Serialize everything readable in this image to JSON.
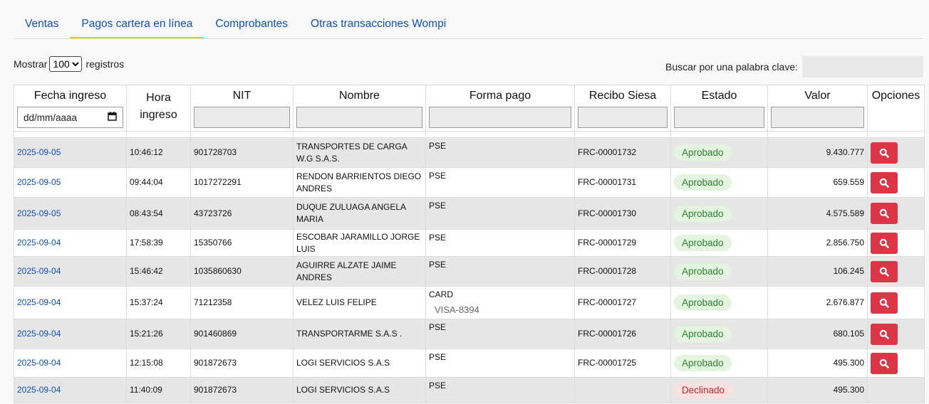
{
  "tabs": [
    {
      "label": "Ventas"
    },
    {
      "label": "Pagos cartera en línea"
    },
    {
      "label": "Comprobantes"
    },
    {
      "label": "Otras transacciones Wompi"
    }
  ],
  "controls": {
    "mostrar_label": "Mostrar",
    "page_size": "100",
    "registros_label": "registros",
    "search_label": "Buscar por una palabra clave:"
  },
  "headers": {
    "fecha": "Fecha ingreso",
    "hora_1": "Hora",
    "hora_2": "ingreso",
    "nit": "NIT",
    "nombre": "Nombre",
    "forma": "Forma pago",
    "recibo": "Recibo Siesa",
    "estado": "Estado",
    "valor": "Valor",
    "opciones": "Opciones",
    "date_placeholder": "dd/mm/aaaa"
  },
  "rows": [
    {
      "fecha": "2025-09-05",
      "hora": "10:46:12",
      "nit": "901728703",
      "nombre": "TRANSPORTES DE CARGA W.G S.A.S.",
      "forma": "PSE",
      "forma_detail": "",
      "recibo": "FRC-00001732",
      "estado": "Aprobado",
      "valor": "9.430.777"
    },
    {
      "fecha": "2025-09-05",
      "hora": "09:44:04",
      "nit": "1017272291",
      "nombre": "RENDON BARRIENTOS DIEGO ANDRES",
      "forma": "PSE",
      "forma_detail": "",
      "recibo": "FRC-00001731",
      "estado": "Aprobado",
      "valor": "659.559"
    },
    {
      "fecha": "2025-09-05",
      "hora": "08:43:54",
      "nit": "43723726",
      "nombre": "DUQUE ZULUAGA ANGELA MARIA",
      "forma": "PSE",
      "forma_detail": "",
      "recibo": "FRC-00001730",
      "estado": "Aprobado",
      "valor": "4.575.589"
    },
    {
      "fecha": "2025-09-04",
      "hora": "17:58:39",
      "nit": "15350766",
      "nombre": "ESCOBAR JARAMILLO JORGE LUIS",
      "forma": "PSE",
      "forma_detail": "",
      "recibo": "FRC-00001729",
      "estado": "Aprobado",
      "valor": "2.856.750"
    },
    {
      "fecha": "2025-09-04",
      "hora": "15:46:42",
      "nit": "1035860630",
      "nombre": "AGUIRRE ALZATE JAIME ANDRES",
      "forma": "PSE",
      "forma_detail": "",
      "recibo": "FRC-00001728",
      "estado": "Aprobado",
      "valor": "106.245"
    },
    {
      "fecha": "2025-09-04",
      "hora": "15:37:24",
      "nit": "71212358",
      "nombre": "VELEZ LUIS FELIPE",
      "forma": "CARD",
      "forma_detail": "VISA-8394",
      "recibo": "FRC-00001727",
      "estado": "Aprobado",
      "valor": "2.676.877"
    },
    {
      "fecha": "2025-09-04",
      "hora": "15:21:26",
      "nit": "901460869",
      "nombre": "TRANSPORTARME S.A.S .",
      "forma": "PSE",
      "forma_detail": "",
      "recibo": "FRC-00001726",
      "estado": "Aprobado",
      "valor": "680.105"
    },
    {
      "fecha": "2025-09-04",
      "hora": "12:15:08",
      "nit": "901872673",
      "nombre": "LOGI SERVICIOS S.A.S",
      "forma": "PSE",
      "forma_detail": "",
      "recibo": "FRC-00001725",
      "estado": "Aprobado",
      "valor": "495.300"
    },
    {
      "fecha": "2025-09-04",
      "hora": "11:40:09",
      "nit": "901872673",
      "nombre": "LOGI SERVICIOS S.A.S",
      "forma": "PSE",
      "forma_detail": "",
      "recibo": "",
      "estado": "Declinado",
      "valor": "495.300"
    }
  ],
  "icons": {
    "option": "search-icon"
  },
  "colors": {
    "link": "#0d4fc0",
    "tab_active_underline": "#f1c40f",
    "button_red": "#dc3545",
    "approved_bg": "#e3f5df",
    "approved_text": "#2e7d32",
    "declined_bg": "#fbe0e0",
    "declined_text": "#c62828"
  }
}
